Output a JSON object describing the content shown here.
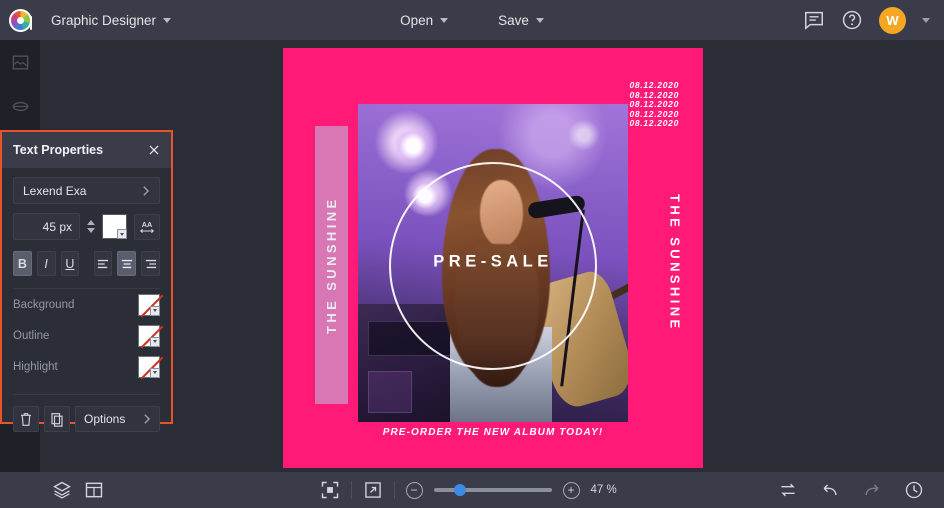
{
  "topbar": {
    "logo_name": "bannersnack-logo",
    "doc_title": "Graphic Designer",
    "open_label": "Open",
    "save_label": "Save",
    "comments_icon": "comment-icon",
    "help_icon": "help-circle-icon",
    "avatar_initial": "W"
  },
  "rail": {
    "items": [
      {
        "icon": "image-icon"
      },
      {
        "icon": "shapes-icon"
      },
      {
        "icon": "text-icon"
      }
    ]
  },
  "panel": {
    "title": "Text Properties",
    "close_icon": "close-icon",
    "font_family": "Lexend Exa",
    "font_size": "45 px",
    "text_color": "#ffffff",
    "letter_spacing_icon": "letter-spacing-icon",
    "format": {
      "bold": "B",
      "italic": "I",
      "underline": "U",
      "bold_active": true,
      "italic_active": false,
      "underline_active": false,
      "align_left": "align-left-icon",
      "align_center": "align-center-icon",
      "align_right": "align-right-icon",
      "active_align": "center"
    },
    "options": [
      {
        "label": "Background",
        "value": "none"
      },
      {
        "label": "Outline",
        "value": "none"
      },
      {
        "label": "Highlight",
        "value": "none"
      }
    ],
    "delete_icon": "trash-icon",
    "duplicate_icon": "duplicate-icon",
    "options_label": "Options",
    "border_color": "#e8542a"
  },
  "canvas": {
    "background_color": "#ff1a78",
    "accent_bar_color": "#d977b4",
    "dates": [
      "08.12.2020",
      "08.12.2020",
      "08.12.2020",
      "08.12.2020",
      "08.12.2020"
    ],
    "left_vertical_text": "THE SUNSHINE",
    "right_vertical_text": "THE SUNSHINE",
    "circle_text": "PRE-SALE",
    "tagline": "PRE-ORDER THE NEW ALBUM TODAY!"
  },
  "bottombar": {
    "layers_icon": "layers-icon",
    "pages_icon": "pages-grid-icon",
    "fit_icon": "fit-to-screen-icon",
    "preview_icon": "preview-expand-icon",
    "zoom_out": "−",
    "zoom_in": "+",
    "zoom_value": "47 %",
    "sync_icon": "sync-icon",
    "undo_icon": "undo-icon",
    "redo_icon": "redo-icon",
    "history_icon": "history-clock-icon"
  }
}
